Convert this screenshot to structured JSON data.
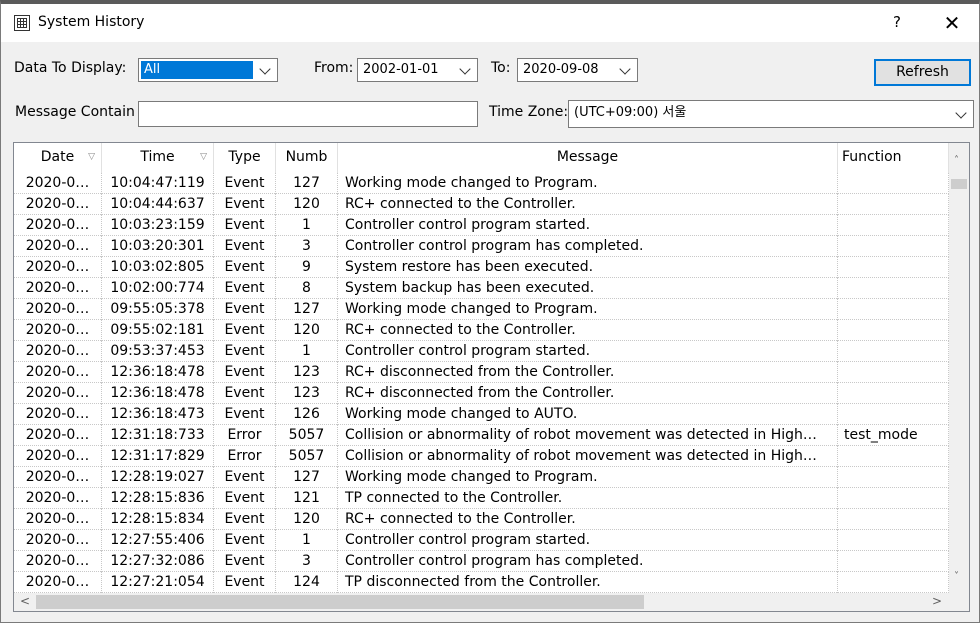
{
  "window": {
    "title": "System History",
    "help": "?",
    "close": "✕"
  },
  "filters": {
    "data_to_display_label": "Data To Display:",
    "data_to_display_value": "All",
    "from_label": "From:",
    "from_value": "2002-01-01",
    "to_label": "To:",
    "to_value": "2020-09-08",
    "refresh_label": "Refresh",
    "message_contain_label": "Message Contain",
    "message_contain_value": "",
    "time_zone_label": "Time Zone:",
    "time_zone_value": "(UTC+09:00) 서울"
  },
  "table": {
    "columns": [
      "Date",
      "Time",
      "Type",
      "Numb",
      "Message",
      "Function"
    ],
    "rows": [
      [
        "2020-0…",
        "10:04:47:119",
        "Event",
        "127",
        "Working mode changed to Program.",
        ""
      ],
      [
        "2020-0…",
        "10:04:44:637",
        "Event",
        "120",
        "RC+ connected to the Controller.",
        ""
      ],
      [
        "2020-0…",
        "10:03:23:159",
        "Event",
        "1",
        "Controller control program started.",
        ""
      ],
      [
        "2020-0…",
        "10:03:20:301",
        "Event",
        "3",
        "Controller control program has completed.",
        ""
      ],
      [
        "2020-0…",
        "10:03:02:805",
        "Event",
        "9",
        "System restore has been executed.",
        ""
      ],
      [
        "2020-0…",
        "10:02:00:774",
        "Event",
        "8",
        "System backup has been executed.",
        ""
      ],
      [
        "2020-0…",
        "09:55:05:378",
        "Event",
        "127",
        "Working mode changed to Program.",
        ""
      ],
      [
        "2020-0…",
        "09:55:02:181",
        "Event",
        "120",
        "RC+ connected to the Controller.",
        ""
      ],
      [
        "2020-0…",
        "09:53:37:453",
        "Event",
        "1",
        "Controller control program started.",
        ""
      ],
      [
        "2020-0…",
        "12:36:18:478",
        "Event",
        "123",
        "RC+ disconnected from the Controller.",
        ""
      ],
      [
        "2020-0…",
        "12:36:18:478",
        "Event",
        "123",
        "RC+ disconnected from the Controller.",
        ""
      ],
      [
        "2020-0…",
        "12:36:18:473",
        "Event",
        "126",
        "Working mode changed to AUTO.",
        ""
      ],
      [
        "2020-0…",
        "12:31:18:733",
        "Error",
        "5057",
        "Collision or abnormality of robot movement was detected in High…",
        "test_mode"
      ],
      [
        "2020-0…",
        "12:31:17:829",
        "Error",
        "5057",
        "Collision or abnormality of robot movement was detected in High…",
        ""
      ],
      [
        "2020-0…",
        "12:28:19:027",
        "Event",
        "127",
        "Working mode changed to Program.",
        ""
      ],
      [
        "2020-0…",
        "12:28:15:836",
        "Event",
        "121",
        "TP connected to the Controller.",
        ""
      ],
      [
        "2020-0…",
        "12:28:15:834",
        "Event",
        "120",
        "RC+ connected to the Controller.",
        ""
      ],
      [
        "2020-0…",
        "12:27:55:406",
        "Event",
        "1",
        "Controller control program started.",
        ""
      ],
      [
        "2020-0…",
        "12:27:32:086",
        "Event",
        "3",
        "Controller control program has completed.",
        ""
      ],
      [
        "2020-0…",
        "12:27:21:054",
        "Event",
        "124",
        "TP disconnected from the Controller.",
        ""
      ]
    ]
  },
  "icons": {
    "dropdown": "chevron-down-icon",
    "scroll_up": "▲",
    "scroll_down": "▼",
    "scroll_left": "<",
    "scroll_right": ">",
    "sort": "▽"
  },
  "colors": {
    "selection": "#0078d7",
    "accent_border": "#0078d7"
  }
}
